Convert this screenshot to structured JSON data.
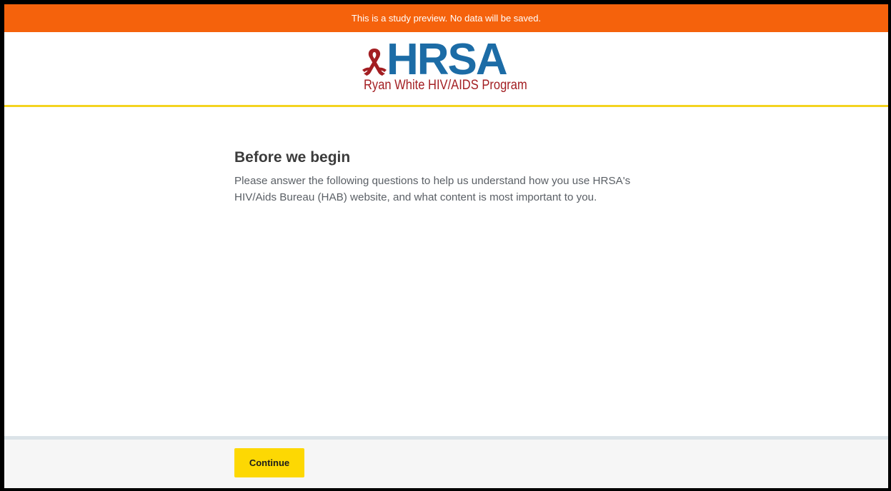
{
  "banner": {
    "text": "This is a study preview. No data will be saved.",
    "color": "#f5620c"
  },
  "header": {
    "logo_wordmark": "HRSA",
    "logo_subtitle": "Ryan White HIV/AIDS Program",
    "accent_line_color": "#f4d31f"
  },
  "main": {
    "title": "Before we begin",
    "body": "Please answer the following questions to help us understand how you use HRSA's HIV/Aids Bureau (HAB) website, and what content is most important to you."
  },
  "footer": {
    "continue_label": "Continue",
    "button_color": "#fdd803"
  },
  "icons": {
    "logo_ribbon": "red-awareness-ribbon-icon"
  }
}
